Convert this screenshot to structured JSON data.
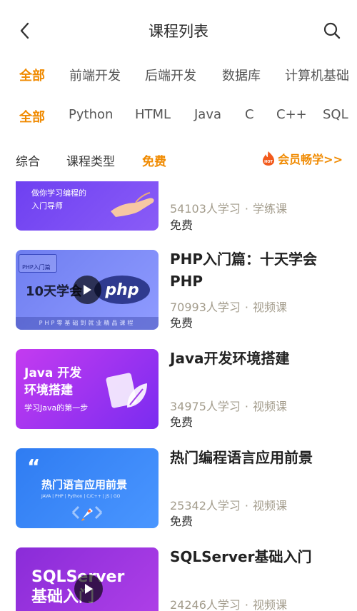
{
  "header": {
    "title": "课程列表",
    "back_icon": "chevron-left-icon",
    "search_icon": "search-icon"
  },
  "category_filters": [
    "全部",
    "前端开发",
    "后端开发",
    "数据库",
    "计算机基础"
  ],
  "language_filters": [
    "全部",
    "Python",
    "HTML",
    "Java",
    "C",
    "C++",
    "SQL"
  ],
  "sort_options": {
    "overall": "综合",
    "type": "课程类型",
    "free": "免费"
  },
  "vip": {
    "label": "会员畅学>>",
    "badge": "HOT"
  },
  "courses": [
    {
      "title": "",
      "learners": "54103人学习",
      "kind": "学练课",
      "price": "免费",
      "thumb_lines": [
        "做你学习编程的",
        "入门导师"
      ]
    },
    {
      "title": "PHP入门篇：十天学会PHP",
      "learners": "70993人学习",
      "kind": "视频课",
      "price": "免费",
      "thumb_tag": "PHP入门篇",
      "thumb_main": "10天学会",
      "thumb_logo": "php",
      "thumb_footer": "PHP零基础到就业精品课程"
    },
    {
      "title": "Java开发环境搭建",
      "learners": "34975人学习",
      "kind": "视频课",
      "price": "免费",
      "thumb_lines": [
        "Java 开发",
        "环境搭建"
      ],
      "thumb_sub": "学习Java的第一步"
    },
    {
      "title": "热门编程语言应用前景",
      "learners": "25342人学习",
      "kind": "视频课",
      "price": "免费",
      "thumb_main": "热门语言应用前景",
      "thumb_sub": "JAVA | PHP | Python | C/C++ | JS | GO"
    },
    {
      "title": "SQLServer基础入门",
      "learners": "24246人学习",
      "kind": "视频课",
      "price": "",
      "thumb_lines": [
        "SQLServer",
        "基础入门"
      ]
    }
  ],
  "meta_separator": "·",
  "colors": {
    "accent": "#f08a00",
    "meta": "#a39c8c"
  }
}
